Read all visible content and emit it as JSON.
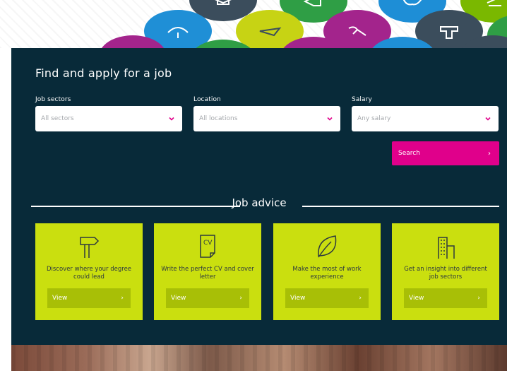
{
  "search": {
    "title": "Find and apply for a job",
    "fields": [
      {
        "label": "Job sectors",
        "placeholder": "All sectors"
      },
      {
        "label": "Location",
        "placeholder": "All locations"
      },
      {
        "label": "Salary",
        "placeholder": "Any salary"
      }
    ],
    "button_label": "Search",
    "button_arrow": "›"
  },
  "advice": {
    "title": "Job advice",
    "cards": [
      {
        "text": "Discover where your degree could lead",
        "icon": "signpost-icon",
        "view_label": "View",
        "arrow": "›"
      },
      {
        "text": "Write the perfect CV and cover letter",
        "icon": "cv-document-icon",
        "view_label": "View",
        "arrow": "›"
      },
      {
        "text": "Make the most of work experience",
        "icon": "leaf-icon",
        "view_label": "View",
        "arrow": "›"
      },
      {
        "text": "Get an insight into different job sectors",
        "icon": "buildings-icon",
        "view_label": "View",
        "arrow": "›"
      }
    ]
  },
  "colors": {
    "panel": "#082a39",
    "accent_pink": "#e0008b",
    "card_lime": "#cadf0f",
    "card_button": "#a8bf06"
  }
}
